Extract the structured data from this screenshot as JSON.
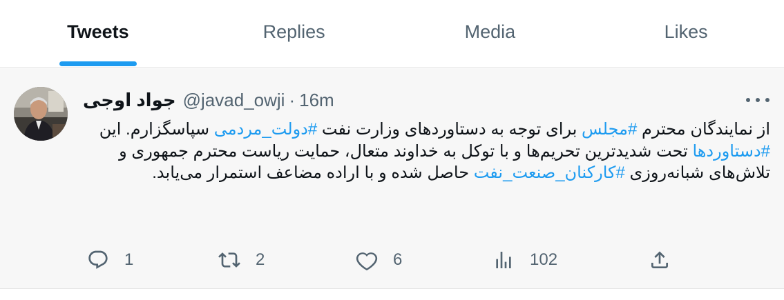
{
  "tabs": [
    {
      "label": "Tweets",
      "active": true
    },
    {
      "label": "Replies",
      "active": false
    },
    {
      "label": "Media",
      "active": false
    },
    {
      "label": "Likes",
      "active": false
    }
  ],
  "tweet": {
    "display_name": "جواد اوجی",
    "handle": "@javad_owji",
    "separator": "·",
    "time": "16m",
    "body": {
      "t1": "از نمایندگان محترم ",
      "h1": "#مجلس",
      "t2": " برای توجه به دستاوردهای وزارت نفت ",
      "h2": "#دولت_مردمی",
      "t3": " سپاسگزارم. این ",
      "h3": "#دستاوردها",
      "t4": " تحت شدیدترین تحریم‌ها و با توکل به خداوند متعال، حمایت ریاست محترم جمهوری و تلاش‌های شبانه‌روزی ",
      "h4": "#کارکنان_صنعت_نفت",
      "t5": " حاصل شده و با اراده مضاعف استمرار می‌یابد."
    },
    "actions": {
      "reply_count": "1",
      "retweet_count": "2",
      "like_count": "6",
      "views_count": "102"
    }
  },
  "icons": {
    "more": "more-horizontal-icon",
    "reply": "reply-icon",
    "retweet": "retweet-icon",
    "like": "heart-icon",
    "views": "views-icon",
    "share": "share-icon"
  },
  "colors": {
    "accent": "#1d9bf0",
    "muted": "#536471",
    "text": "#0f1419",
    "tweet_bg": "#f7f7f7"
  }
}
